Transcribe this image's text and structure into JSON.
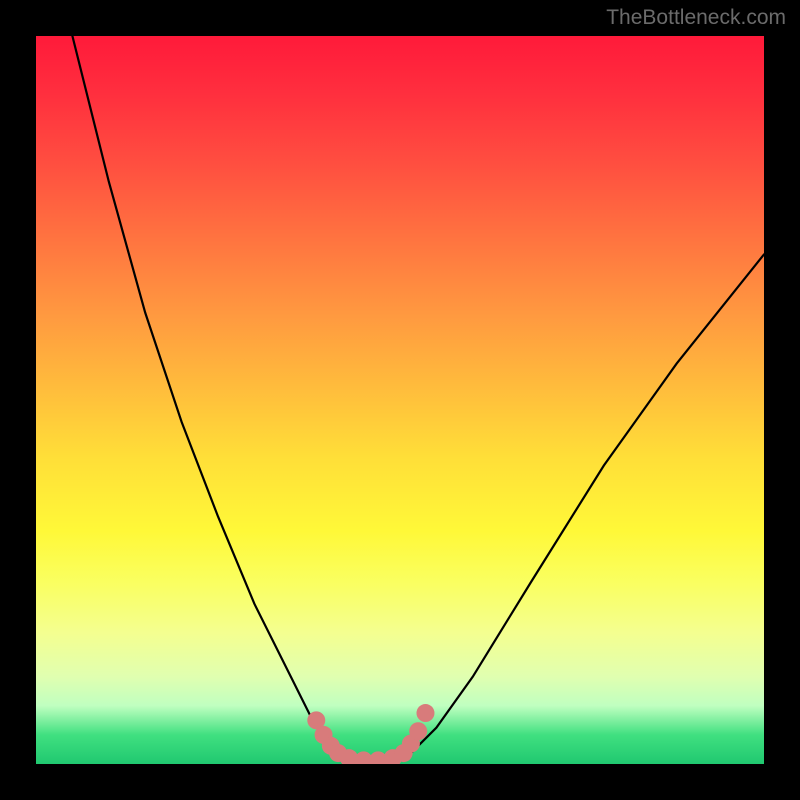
{
  "watermark": "TheBottleneck.com",
  "chart_data": {
    "type": "line",
    "title": "",
    "xlabel": "",
    "ylabel": "",
    "xlim": [
      0,
      100
    ],
    "ylim": [
      0,
      100
    ],
    "gradient_colors": {
      "top": "#ff1a3a",
      "mid_upper": "#ff9840",
      "mid": "#fff838",
      "mid_lower": "#e0ffb0",
      "bottom": "#20c870"
    },
    "series": [
      {
        "name": "left-curve",
        "color": "#000000",
        "x": [
          5,
          10,
          15,
          20,
          25,
          30,
          35,
          38,
          40,
          42
        ],
        "y": [
          100,
          80,
          62,
          47,
          34,
          22,
          12,
          6,
          3,
          1
        ]
      },
      {
        "name": "valley-floor",
        "color": "#000000",
        "x": [
          42,
          45,
          48,
          51
        ],
        "y": [
          1,
          0,
          0,
          1
        ]
      },
      {
        "name": "right-curve",
        "color": "#000000",
        "x": [
          51,
          55,
          60,
          68,
          78,
          88,
          100
        ],
        "y": [
          1,
          5,
          12,
          25,
          41,
          55,
          70
        ]
      },
      {
        "name": "overlay-markers",
        "color": "#d87b7b",
        "type": "scatter",
        "x": [
          38.5,
          39.5,
          40.5,
          41.5,
          43,
          45,
          47,
          49,
          50.5,
          51.5,
          52.5,
          53.5
        ],
        "y": [
          6,
          4,
          2.5,
          1.5,
          0.8,
          0.5,
          0.5,
          0.8,
          1.5,
          2.8,
          4.5,
          7
        ]
      }
    ]
  }
}
